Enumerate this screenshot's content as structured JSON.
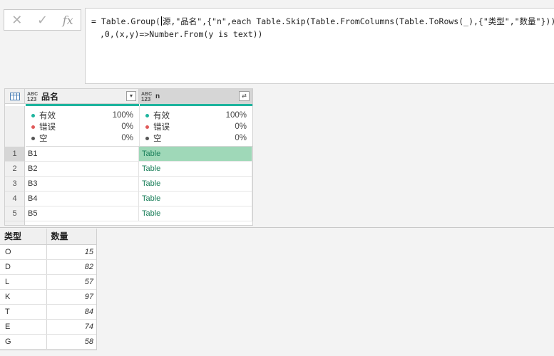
{
  "formula_bar": {
    "cancel_icon": "close-icon",
    "confirm_icon": "check-icon",
    "fx_label": "fx",
    "line1_a": "= Table.Group(",
    "line1_b": "源,\"品名\",{\"n\",each Table.Skip(Table.FromColumns(Table.ToRows(_),{\"类型\",\"数量\"})) }",
    "line2": ",0,(x,y)=>Number.From(y is text))"
  },
  "grid": {
    "columns": [
      {
        "type_top": "ABC",
        "type_bottom": "123",
        "name": "品名"
      },
      {
        "type_top": "ABC",
        "type_bottom": "123",
        "name": "n"
      }
    ],
    "profile_labels": [
      "有效",
      "错误",
      "空"
    ],
    "profile_col1": [
      "100%",
      "0%",
      "0%"
    ],
    "profile_col2": [
      "100%",
      "0%",
      "0%"
    ],
    "profile_colors": [
      "#1eb49e",
      "#e05a5a",
      "#555555"
    ],
    "rows": [
      {
        "num": "1",
        "name": "B1",
        "n": "Table"
      },
      {
        "num": "2",
        "name": "B2",
        "n": "Table"
      },
      {
        "num": "3",
        "name": "B3",
        "n": "Table"
      },
      {
        "num": "4",
        "name": "B4",
        "n": "Table"
      },
      {
        "num": "5",
        "name": "B5",
        "n": "Table"
      }
    ],
    "selected_row": 1
  },
  "preview": {
    "headers": [
      "类型",
      "数量"
    ],
    "rows": [
      [
        "O",
        "15"
      ],
      [
        "D",
        "82"
      ],
      [
        "L",
        "57"
      ],
      [
        "K",
        "97"
      ],
      [
        "T",
        "84"
      ],
      [
        "E",
        "74"
      ],
      [
        "G",
        "58"
      ]
    ]
  }
}
